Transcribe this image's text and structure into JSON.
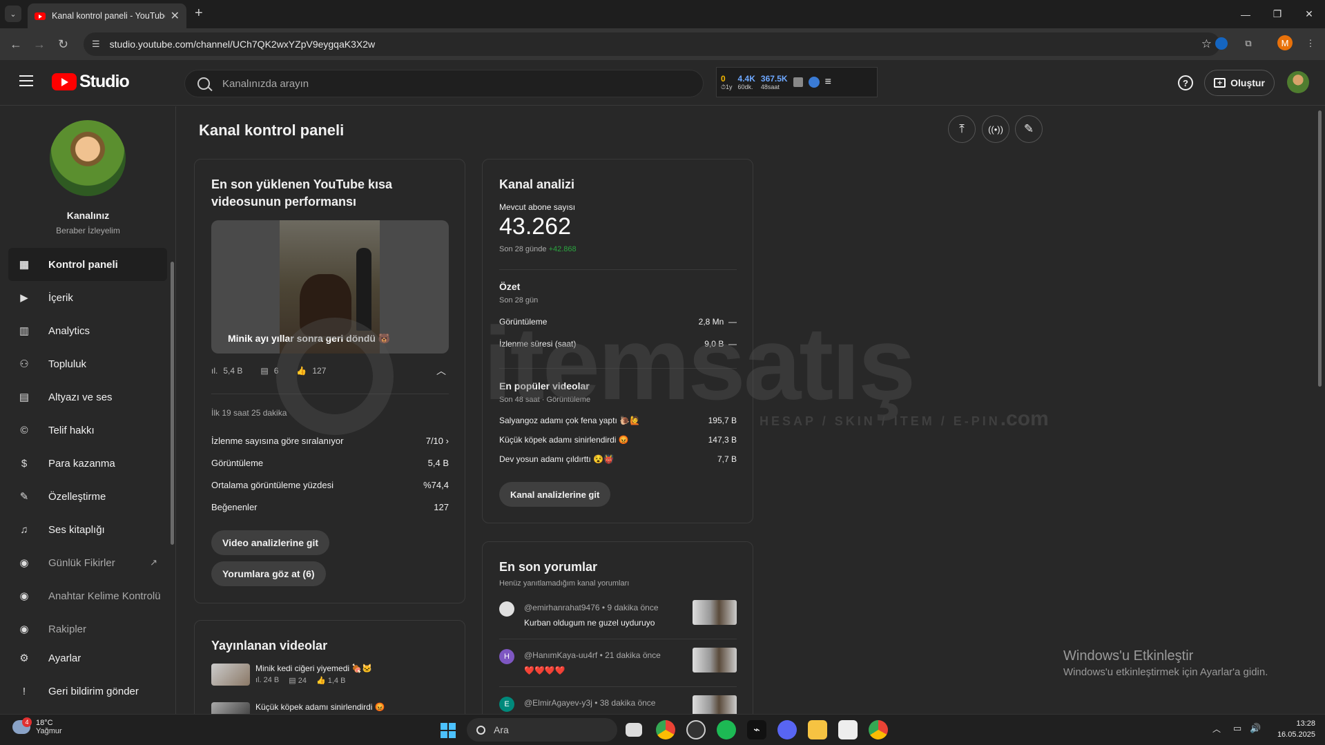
{
  "browser": {
    "tab_title": "Kanal kontrol paneli - YouTube Studio",
    "url": "studio.youtube.com/channel/UCh7QK2wxYZpV9eygqaK3X2w",
    "profile_initial": "M"
  },
  "header": {
    "logo_text": "Studio",
    "search_placeholder": "Kanalınızda arayın",
    "create_label": "Oluştur",
    "stats": [
      {
        "value": "0",
        "label": "⏱1y",
        "color": "#f5b800"
      },
      {
        "value": "4.4K",
        "label": "60dk.",
        "color": "#6ea8ff"
      },
      {
        "value": "367.5K",
        "label": "48saat",
        "color": "#6ea8ff"
      }
    ]
  },
  "sidebar": {
    "channel_name": "Kanalınız",
    "channel_handle": "Beraber İzleyelim",
    "items": [
      {
        "label": "Kontrol paneli",
        "icon": "dashboard-icon",
        "glyph": "▦"
      },
      {
        "label": "İçerik",
        "icon": "content-icon",
        "glyph": "▶"
      },
      {
        "label": "Analytics",
        "icon": "analytics-icon",
        "glyph": "▥"
      },
      {
        "label": "Topluluk",
        "icon": "community-icon",
        "glyph": "⚇"
      },
      {
        "label": "Altyazı ve ses",
        "icon": "subtitles-icon",
        "glyph": "▤"
      },
      {
        "label": "Telif hakkı",
        "icon": "copyright-icon",
        "glyph": "©"
      },
      {
        "label": "Para kazanma",
        "icon": "monetization-icon",
        "glyph": "$"
      },
      {
        "label": "Özelleştirme",
        "icon": "customization-icon",
        "glyph": "✎"
      },
      {
        "label": "Ses kitaplığı",
        "icon": "audio-library-icon",
        "glyph": "♫"
      },
      {
        "label": "Günlük Fikirler",
        "icon": "extension-icon",
        "glyph": "◉"
      },
      {
        "label": "Anahtar Kelime Kontrolü",
        "icon": "extension-icon",
        "glyph": "◉"
      },
      {
        "label": "Rakipler",
        "icon": "extension-icon",
        "glyph": "◉"
      },
      {
        "label": "Ayarlar",
        "icon": "settings-icon",
        "glyph": "⚙"
      },
      {
        "label": "Geri bildirim gönder",
        "icon": "feedback-icon",
        "glyph": "!"
      }
    ]
  },
  "main": {
    "page_title": "Kanal kontrol paneli",
    "latest_short": {
      "title": "En son yüklenen YouTube kısa videosunun performansı",
      "caption": "Minik ayı yıllar sonra geri döndü 🐻",
      "views": "5,4 B",
      "comments": "6",
      "likes": "127",
      "period": "İlk 19 saat 25 dakika",
      "rows": [
        {
          "label": "İzlenme sayısına göre sıralanıyor",
          "value": "7/10"
        },
        {
          "label": "Görüntüleme",
          "value": "5,4 B"
        },
        {
          "label": "Ortalama görüntüleme yüzdesi",
          "value": "%74,4"
        },
        {
          "label": "Beğenenler",
          "value": "127"
        }
      ],
      "btn_analytics": "Video analizlerine git",
      "btn_comments": "Yorumlara göz at (6)"
    },
    "published": {
      "title": "Yayınlanan videolar",
      "videos": [
        {
          "title": "Minik kedi ciğeri yiyemedi 🍖🐱",
          "views": "24 B",
          "comments": "24",
          "likes": "1,4 B"
        },
        {
          "title": "Küçük köpek adamı sinirlendirdi 😡"
        }
      ]
    },
    "analytics": {
      "title": "Kanal analizi",
      "subs_label": "Mevcut abone sayısı",
      "subs_value": "43.262",
      "subs_period": "Son 28 günde",
      "subs_delta": "+42.868",
      "summary_title": "Özet",
      "summary_period": "Son 28 gün",
      "summary_rows": [
        {
          "label": "Görüntüleme",
          "value": "2,8 Mn",
          "trend": "—"
        },
        {
          "label": "İzlenme süresi (saat)",
          "value": "9,0 B",
          "trend": "—"
        }
      ],
      "top_title": "En popüler videolar",
      "top_period": "Son 48 saat · Görüntüleme",
      "top_rows": [
        {
          "label": "Salyangoz adamı çok fena yaptı 🐌🙋",
          "value": "195,7 B"
        },
        {
          "label": "Küçük köpek adamı sinirlendirdi 😡",
          "value": "147,3 B"
        },
        {
          "label": "Dev yosun adamı çıldırttı 😵👹",
          "value": "7,7 B"
        }
      ],
      "btn": "Kanal analizlerine git"
    },
    "comments": {
      "title": "En son yorumlar",
      "subtitle": "Henüz yanıtlamadığım kanal yorumları",
      "items": [
        {
          "user": "@emirhanrahat9476",
          "time": "9 dakika önce",
          "text": "Kurban oldugum ne guzel uyduruyo",
          "initial": "",
          "color": "#e0e0e0"
        },
        {
          "user": "@HanımKaya-uu4rf",
          "time": "21 dakika önce",
          "text": "❤️❤️❤️❤️",
          "initial": "H",
          "color": "#7e57c2"
        },
        {
          "user": "@ElmirAgayev-y3j",
          "time": "38 dakika önce",
          "text": "",
          "initial": "E",
          "color": "#00897b"
        }
      ]
    }
  },
  "watermark": {
    "word": "itemsatış",
    "sub": "HESAP / SKIN / ITEM / E-PIN",
    "dotcom": ".com"
  },
  "activation": {
    "title": "Windows'u Etkinleştir",
    "subtitle": "Windows'u etkinleştirmek için Ayarlar'a gidin."
  },
  "taskbar": {
    "temp": "18°C",
    "weather": "Yağmur",
    "badge": "4",
    "search": "Ara",
    "time": "13:28",
    "date": "16.05.2025"
  }
}
